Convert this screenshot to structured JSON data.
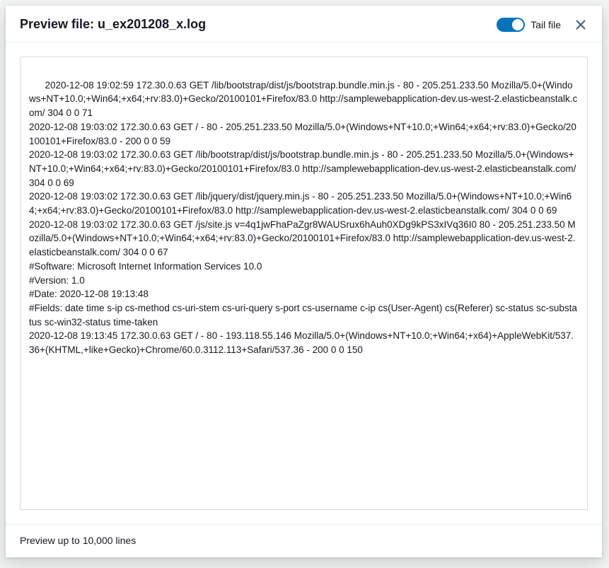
{
  "header": {
    "title": "Preview file: u_ex201208_x.log",
    "toggleLabel": "Tail file"
  },
  "log": {
    "content": "2020-12-08 19:02:59 172.30.0.63 GET /lib/bootstrap/dist/js/bootstrap.bundle.min.js - 80 - 205.251.233.50 Mozilla/5.0+(Windows+NT+10.0;+Win64;+x64;+rv:83.0)+Gecko/20100101+Firefox/83.0 http://samplewebapplication-dev.us-west-2.elasticbeanstalk.com/ 304 0 0 71\n2020-12-08 19:03:02 172.30.0.63 GET / - 80 - 205.251.233.50 Mozilla/5.0+(Windows+NT+10.0;+Win64;+x64;+rv:83.0)+Gecko/20100101+Firefox/83.0 - 200 0 0 59\n2020-12-08 19:03:02 172.30.0.63 GET /lib/bootstrap/dist/js/bootstrap.bundle.min.js - 80 - 205.251.233.50 Mozilla/5.0+(Windows+NT+10.0;+Win64;+x64;+rv:83.0)+Gecko/20100101+Firefox/83.0 http://samplewebapplication-dev.us-west-2.elasticbeanstalk.com/ 304 0 0 69\n2020-12-08 19:03:02 172.30.0.63 GET /lib/jquery/dist/jquery.min.js - 80 - 205.251.233.50 Mozilla/5.0+(Windows+NT+10.0;+Win64;+x64;+rv:83.0)+Gecko/20100101+Firefox/83.0 http://samplewebapplication-dev.us-west-2.elasticbeanstalk.com/ 304 0 0 69\n2020-12-08 19:03:02 172.30.0.63 GET /js/site.js v=4q1jwFhaPaZgr8WAUSrux6hAuh0XDg9kPS3xIVq36I0 80 - 205.251.233.50 Mozilla/5.0+(Windows+NT+10.0;+Win64;+x64;+rv:83.0)+Gecko/20100101+Firefox/83.0 http://samplewebapplication-dev.us-west-2.elasticbeanstalk.com/ 304 0 0 67\n#Software: Microsoft Internet Information Services 10.0\n#Version: 1.0\n#Date: 2020-12-08 19:13:48\n#Fields: date time s-ip cs-method cs-uri-stem cs-uri-query s-port cs-username c-ip cs(User-Agent) cs(Referer) sc-status sc-substatus sc-win32-status time-taken\n2020-12-08 19:13:45 172.30.0.63 GET / - 80 - 193.118.55.146 Mozilla/5.0+(Windows+NT+10.0;+Win64;+x64)+AppleWebKit/537.36+(KHTML,+like+Gecko)+Chrome/60.0.3112.113+Safari/537.36 - 200 0 0 150"
  },
  "footer": {
    "text": "Preview up to 10,000 lines"
  }
}
